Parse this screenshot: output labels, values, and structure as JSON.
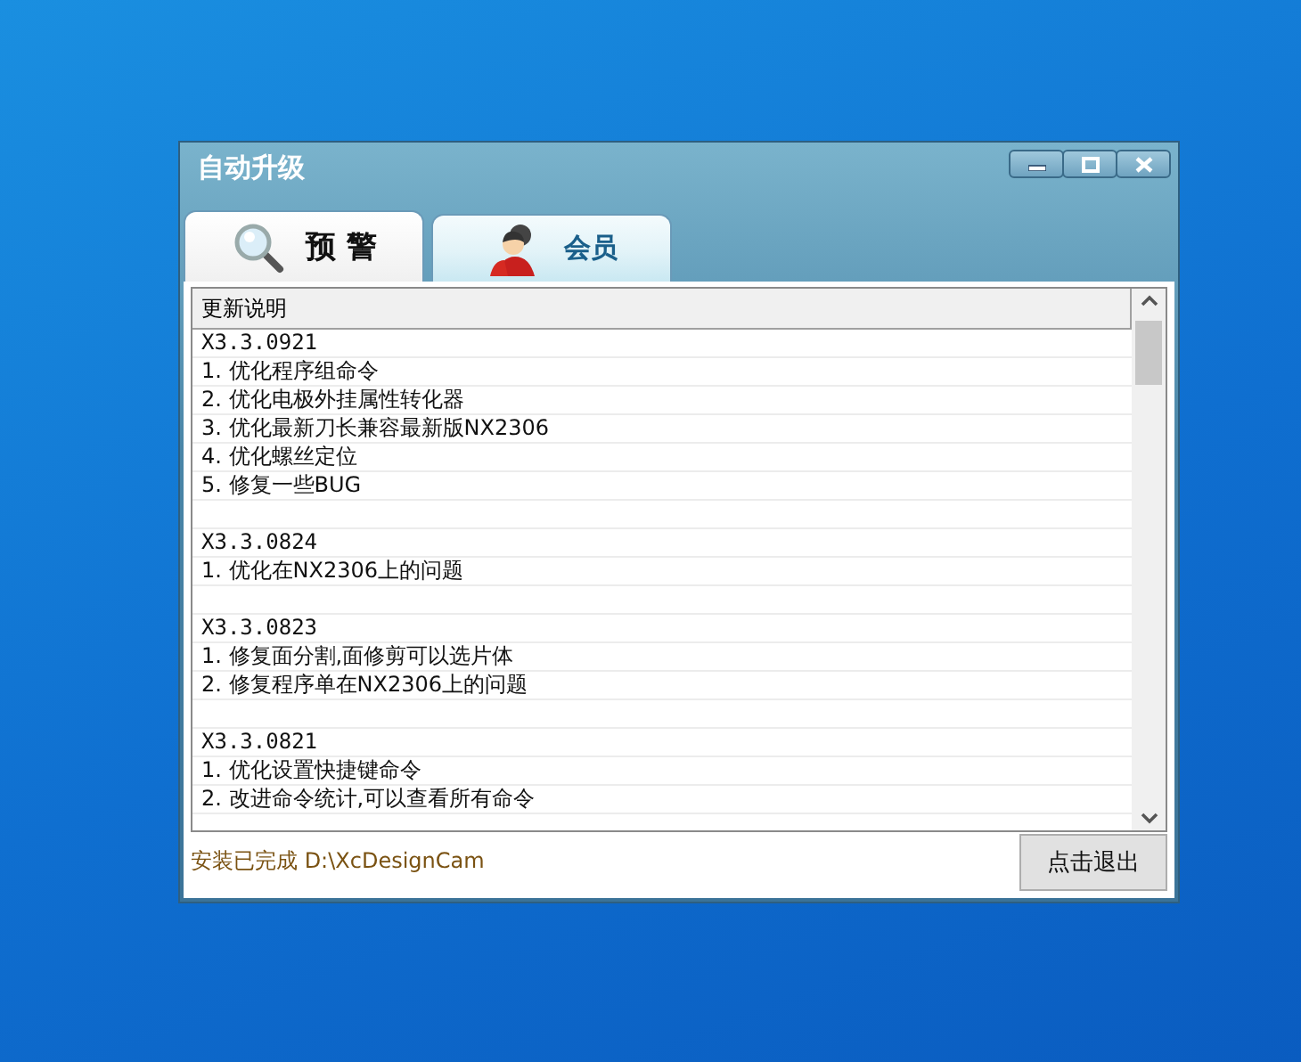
{
  "window": {
    "title": "自动升级"
  },
  "tabs": [
    {
      "label": "预 警",
      "kind": "search",
      "selected": true
    },
    {
      "label": "会员",
      "kind": "user",
      "selected": false
    }
  ],
  "list": {
    "header": "更新说明",
    "releases": [
      {
        "version": "X3.3.0921",
        "items": [
          "1. 优化程序组命令",
          "2. 优化电极外挂属性转化器",
          "3. 优化最新刀长兼容最新版NX2306",
          "4. 优化螺丝定位",
          "5. 修复一些BUG"
        ]
      },
      {
        "version": "X3.3.0824",
        "items": [
          "1. 优化在NX2306上的问题"
        ]
      },
      {
        "version": "X3.3.0823",
        "items": [
          "1. 修复面分割,面修剪可以选片体",
          "2. 修复程序单在NX2306上的问题"
        ]
      },
      {
        "version": "X3.3.0821",
        "items": [
          "1. 优化设置快捷键命令",
          "2. 改进命令统计,可以查看所有命令"
        ]
      }
    ]
  },
  "status": "安装已完成 D:\\XcDesignCam",
  "button": "点击退出"
}
